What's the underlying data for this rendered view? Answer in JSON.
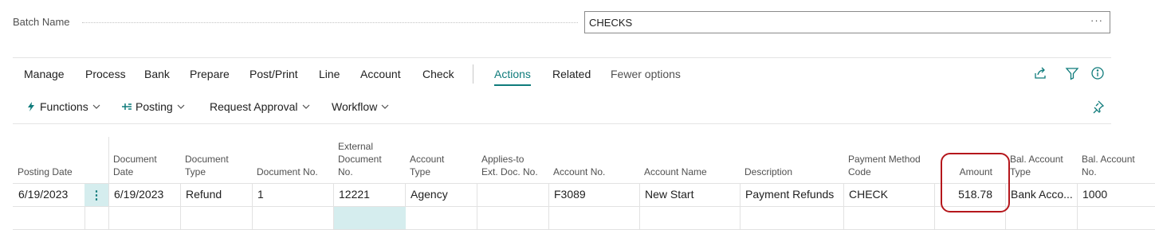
{
  "batch": {
    "label": "Batch Name",
    "value": "CHECKS",
    "more_glyph": "···"
  },
  "tabs": [
    {
      "label": "Manage"
    },
    {
      "label": "Process"
    },
    {
      "label": "Bank"
    },
    {
      "label": "Prepare"
    },
    {
      "label": "Post/Print"
    },
    {
      "label": "Line"
    },
    {
      "label": "Account"
    },
    {
      "label": "Check"
    },
    {
      "label": "Actions",
      "active": true
    },
    {
      "label": "Related"
    },
    {
      "label": "Fewer options"
    }
  ],
  "toolbar_icons": [
    "share-icon",
    "filter-icon",
    "info-icon",
    "pin-icon"
  ],
  "sub_actions": [
    {
      "label": "Functions",
      "icon": "lightning-icon"
    },
    {
      "label": "Posting",
      "icon": "post-icon"
    },
    {
      "label": "Request Approval"
    },
    {
      "label": "Workflow"
    }
  ],
  "columns": {
    "posting_date": "Posting Date",
    "document_date": [
      "Document",
      "Date"
    ],
    "document_type": [
      "Document",
      "Type"
    ],
    "document_no": "Document No.",
    "external_document_no": [
      "External",
      "Document",
      "No."
    ],
    "account_type": [
      "Account",
      "Type"
    ],
    "applies_to_ext_doc_no": [
      "Applies-to",
      "Ext. Doc. No."
    ],
    "account_no": "Account No.",
    "account_name": "Account Name",
    "description": "Description",
    "payment_method_code": [
      "Payment Method",
      "Code"
    ],
    "amount": "Amount",
    "bal_account_type": [
      "Bal. Account",
      "Type"
    ],
    "bal_account_no": [
      "Bal. Account",
      "No."
    ]
  },
  "rows": [
    {
      "posting_date": "6/19/2023",
      "row_menu": "⋮",
      "document_date": "6/19/2023",
      "document_type": "Refund",
      "document_no": "1",
      "external_document_no": "12221",
      "account_type": "Agency",
      "applies_to_ext_doc_no": "",
      "account_no": "F3089",
      "account_name": "New Start",
      "description": "Payment Refunds",
      "payment_method_code": "CHECK",
      "amount": "518.78",
      "bal_account_type": "Bank Acco...",
      "bal_account_no": "1000"
    }
  ],
  "colors": {
    "accent": "#0f7b7b",
    "highlight_annotation": "#b5171c",
    "selection_fill": "#d5edee"
  }
}
